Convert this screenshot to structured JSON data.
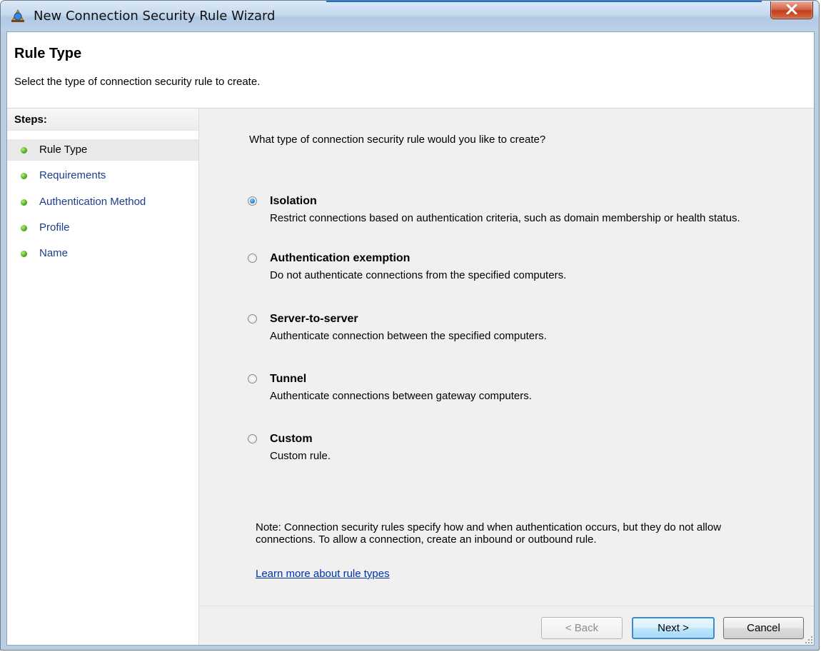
{
  "window": {
    "title": "New Connection Security Rule Wizard",
    "close_symbol": "X"
  },
  "header": {
    "title": "Rule Type",
    "subtitle": "Select the type of connection security rule to create."
  },
  "steps": {
    "title": "Steps:",
    "items": [
      {
        "label": "Rule Type",
        "active": true
      },
      {
        "label": "Requirements",
        "active": false
      },
      {
        "label": "Authentication Method",
        "active": false
      },
      {
        "label": "Profile",
        "active": false
      },
      {
        "label": "Name",
        "active": false
      }
    ]
  },
  "main": {
    "question": "What type of connection security rule would you like to create?",
    "options": [
      {
        "title": "Isolation",
        "description": "Restrict connections based on authentication criteria, such as domain membership or health status.",
        "checked": true
      },
      {
        "title": "Authentication exemption",
        "description": "Do not authenticate connections from the specified computers.",
        "checked": false
      },
      {
        "title": "Server-to-server",
        "description": "Authenticate connection between the specified computers.",
        "checked": false
      },
      {
        "title": "Tunnel",
        "description": "Authenticate connections between gateway computers.",
        "checked": false
      },
      {
        "title": "Custom",
        "description": "Custom rule.",
        "checked": false
      }
    ],
    "note": "Note:  Connection security rules specify how and when authentication occurs, but they do not allow connections.  To allow a connection, create an inbound or outbound rule.",
    "learn_more": "Learn more about rule types"
  },
  "buttons": {
    "back": "< Back",
    "next": "Next >",
    "cancel": "Cancel"
  },
  "colors": {
    "accent": "#1f6ed4",
    "link": "#0033aa",
    "step_link": "#1c3d8c",
    "close_button": "#c13d1c"
  },
  "icons": {
    "app": "shield-globe-icon",
    "close": "close-icon",
    "step_bullet": "green-bullet-icon",
    "resize": "resize-grip-icon"
  }
}
